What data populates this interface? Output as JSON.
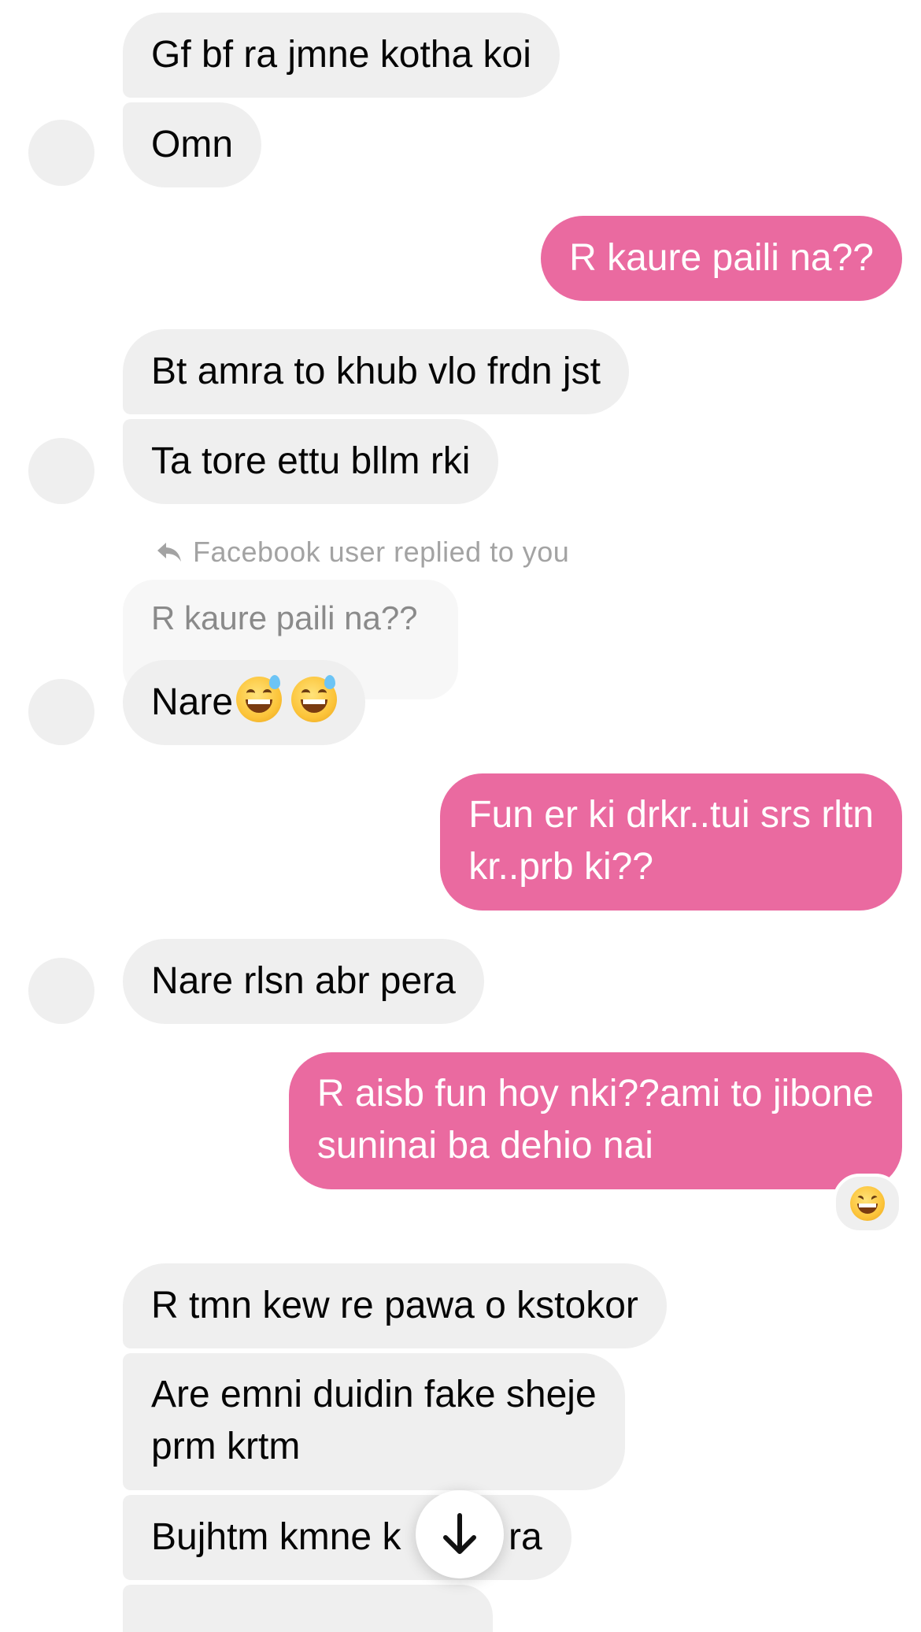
{
  "messages": [
    {
      "text": "Gf bf ra jmne kotha koi"
    },
    {
      "text": "Omn"
    },
    {
      "text": "R kaure paili na??"
    },
    {
      "text": "Bt amra to khub vlo frdn jst"
    },
    {
      "text": "Ta tore ettu bllm rki"
    },
    {
      "text": "Nare"
    },
    {
      "text": "Fun er ki drkr..tui srs rltn",
      "text2": "kr..prb ki??"
    },
    {
      "text": "Nare rlsn abr pera"
    },
    {
      "text": "R aisb fun hoy nki??ami to jibone",
      "text2": "suninai ba dehio nai"
    },
    {
      "text": "R tmn kew re pawa o kstokor"
    },
    {
      "text": "Are emni duidin fake sheje",
      "text2": "prm krtm"
    },
    {
      "text": "Bujhtm kmne k",
      "text2": "ra"
    }
  ],
  "reply": {
    "note": "Facebook user replied to you",
    "quoted": "R kaure paili na??"
  },
  "icons": {
    "reply": "reply-arrow-icon",
    "emoji_sweat": "grinning-sweat-emoji",
    "emoji_laugh": "laughing-squint-emoji",
    "scroll": "arrow-down-icon"
  },
  "colors": {
    "outgoing": "#ea6aa0",
    "incoming": "#efefef"
  }
}
